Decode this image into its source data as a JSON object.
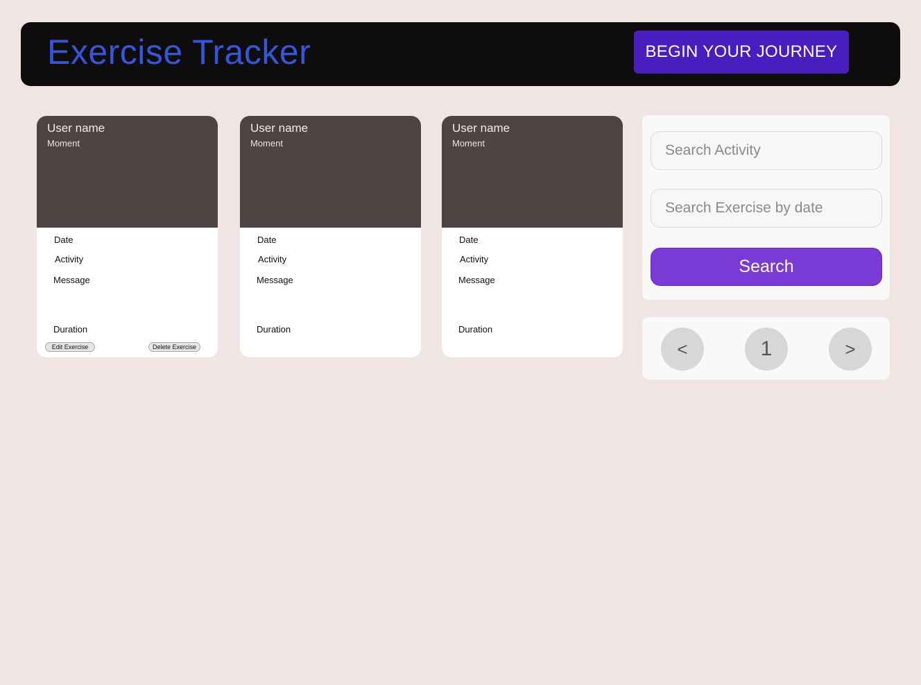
{
  "header": {
    "title": "Exercise Tracker",
    "cta_label": "BEGIN YOUR JOURNEY"
  },
  "cards": [
    {
      "user_name": "User name",
      "moment": "Moment",
      "date_label": "Date",
      "activity_label": "Activity",
      "message_label": "Message",
      "duration_label": "Duration",
      "edit_label": "Edit Exercise",
      "delete_label": "Delete Exercise"
    },
    {
      "user_name": "User name",
      "moment": "Moment",
      "date_label": "Date",
      "activity_label": "Activity",
      "message_label": "Message",
      "duration_label": "Duration"
    },
    {
      "user_name": "User name",
      "moment": "Moment",
      "date_label": "Date",
      "activity_label": "Activity",
      "message_label": "Message",
      "duration_label": "Duration"
    }
  ],
  "search": {
    "activity_placeholder": "Search Activity",
    "date_placeholder": "Search Exercise by date",
    "button_label": "Search"
  },
  "pagination": {
    "prev_label": "<",
    "current_page": "1",
    "next_label": ">"
  },
  "colors": {
    "background": "#f0e4e4",
    "header_bg": "#0f0d0c",
    "title": "#3556dc",
    "cta": "#4a1dbf",
    "card_top": "#4d4443",
    "search_button": "#7a3ad6"
  }
}
